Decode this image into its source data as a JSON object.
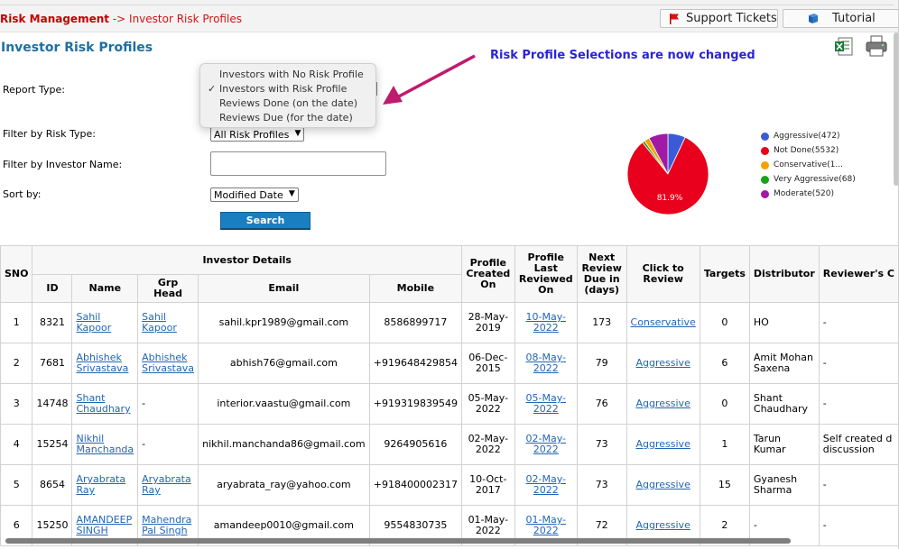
{
  "breadcrumb": {
    "module": "Risk Management",
    "separator": "->",
    "current": "Investor Risk Profiles"
  },
  "top_buttons": {
    "support": "Support Tickets",
    "tutorial": "Tutorial"
  },
  "page_title": "Investor Risk Profiles",
  "annotation": "Risk Profile Selections are now changed",
  "colors": {
    "title": "#1d6fa0",
    "annotation": "#2a24d6",
    "arrow": "#c01a6e",
    "link": "#1f66b5",
    "search_button": "#1a7fc1"
  },
  "filters": {
    "report_type_label": "Report Type:",
    "report_type_options": [
      {
        "label": "Investors with No Risk Profile",
        "check": ""
      },
      {
        "label": "Investors with Risk Profile",
        "check": "✓"
      },
      {
        "label": "Reviews Done (on the date)",
        "check": ""
      },
      {
        "label": "Reviews Due (for the date)",
        "check": ""
      }
    ],
    "risk_type_label": "Filter by Risk Type:",
    "risk_type_value": "All Risk Profiles",
    "investor_name_label": "Filter by Investor Name:",
    "investor_name_value": "",
    "sort_label": "Sort by:",
    "sort_value": "Modified Date",
    "search_label": "Search"
  },
  "chart_data": {
    "type": "pie",
    "slices": [
      {
        "label": "Aggressive(472)",
        "value": 472,
        "color": "#3b5bd6"
      },
      {
        "label": "Not Done(5532)",
        "value": 5532,
        "color": "#e8001c"
      },
      {
        "label": "Conservative(1...",
        "value": 140,
        "color": "#f5a000"
      },
      {
        "label": "Very Aggressive(68)",
        "value": 68,
        "color": "#1aa11a"
      },
      {
        "label": "Moderate(520)",
        "value": 520,
        "color": "#a01aa5"
      }
    ],
    "data_label": "81.9%",
    "legend_position": "right"
  },
  "table": {
    "group_header": "Investor Details",
    "headers": {
      "sno": "SNO",
      "id": "ID",
      "name": "Name",
      "grp_head": "Grp Head",
      "email": "Email",
      "mobile": "Mobile",
      "created": "Profile Created On",
      "reviewed": "Profile Last Reviewed On",
      "next_review": "Next Review Due in (days)",
      "click_review": "Click to Review",
      "targets": "Targets",
      "distributor": "Distributor",
      "reviewer": "Reviewer's C"
    },
    "rows": [
      {
        "sno": "1",
        "id": "8321",
        "name": "Sahil Kapoor",
        "grp_head": "Sahil Kapoor",
        "email": "sahil.kpr1989@gmail.com",
        "mobile": "8586899717",
        "created": "28-May-2019",
        "reviewed": "10-May-2022",
        "next_review": "173",
        "click_review": "Conservative",
        "targets": "0",
        "distributor": "HO",
        "reviewer": "-"
      },
      {
        "sno": "2",
        "id": "7681",
        "name": "Abhishek Srivastava",
        "grp_head": "Abhishek Srivastava",
        "email": "abhish76@gmail.com",
        "mobile": "+919648429854",
        "created": "06-Dec-2015",
        "reviewed": "08-May-2022",
        "next_review": "79",
        "click_review": "Aggressive",
        "targets": "6",
        "distributor": "Amit Mohan Saxena",
        "reviewer": "-"
      },
      {
        "sno": "3",
        "id": "14748",
        "name": "Shant Chaudhary",
        "grp_head": "-",
        "email": "interior.vaastu@gmail.com",
        "mobile": "+919319839549",
        "created": "05-May-2022",
        "reviewed": "05-May-2022",
        "next_review": "76",
        "click_review": "Aggressive",
        "targets": "0",
        "distributor": "Shant Chaudhary",
        "reviewer": "-"
      },
      {
        "sno": "4",
        "id": "15254",
        "name": "Nikhil Manchanda",
        "grp_head": "-",
        "email": "nikhil.manchanda86@gmail.com",
        "mobile": "9264905616",
        "created": "02-May-2022",
        "reviewed": "02-May-2022",
        "next_review": "73",
        "click_review": "Aggressive",
        "targets": "1",
        "distributor": "Tarun Kumar",
        "reviewer": "Self created d discussion"
      },
      {
        "sno": "5",
        "id": "8654",
        "name": "Aryabrata Ray",
        "grp_head": "Aryabrata Ray",
        "email": "aryabrata_ray@yahoo.com",
        "mobile": "+918400002317",
        "created": "10-Oct-2017",
        "reviewed": "02-May-2022",
        "next_review": "73",
        "click_review": "Aggressive",
        "targets": "15",
        "distributor": "Gyanesh Sharma",
        "reviewer": "-"
      },
      {
        "sno": "6",
        "id": "15250",
        "name": "AMANDEEP SINGH",
        "grp_head": "Mahendra Pal Singh",
        "email": "amandeep0010@gmail.com",
        "mobile": "9554830735",
        "created": "01-May-2022",
        "reviewed": "01-May-2022",
        "next_review": "72",
        "click_review": "Aggressive",
        "targets": "2",
        "distributor": "-",
        "reviewer": "-"
      }
    ]
  }
}
